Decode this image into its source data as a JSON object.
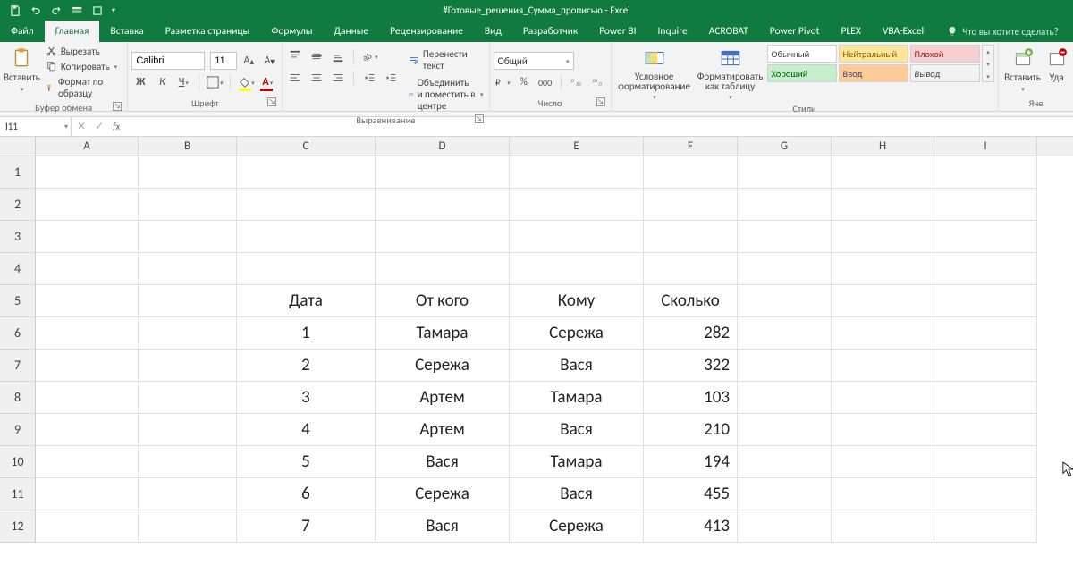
{
  "title": "#Готовые_решения_Сумма_прописью - Excel",
  "tabs": {
    "file": "Файл",
    "items": [
      "Главная",
      "Вставка",
      "Разметка страницы",
      "Формулы",
      "Данные",
      "Рецензирование",
      "Вид",
      "Разработчик",
      "Power BI",
      "Inquire",
      "ACROBAT",
      "Power Pivot",
      "PLEX",
      "VBA-Excel"
    ],
    "activeIndex": 0,
    "tellme": "Что вы хотите сделать?"
  },
  "ribbon": {
    "clipboard": {
      "label": "Буфер обмена",
      "paste": "Вставить",
      "cut": "Вырезать",
      "copy": "Копировать",
      "painter": "Формат по образцу"
    },
    "font": {
      "label": "Шрифт",
      "name": "Calibri",
      "size": "11"
    },
    "align": {
      "label": "Выравнивание",
      "wrap": "Перенести текст",
      "merge": "Объединить и поместить в центре"
    },
    "number": {
      "label": "Число",
      "format": "Общий"
    },
    "stylesGroup": {
      "label": "Стили",
      "cond": "Условное форматирование",
      "table": "Форматировать как таблицу",
      "cells": [
        "Обычный",
        "Нейтральный",
        "Плохой",
        "Хороший",
        "Ввод",
        "Вывод"
      ]
    },
    "cells": {
      "label": "Яче",
      "insert": "Вставить",
      "delete": "Уда"
    }
  },
  "formula": {
    "name": "I11",
    "value": ""
  },
  "sheet": {
    "columns": [
      "A",
      "B",
      "C",
      "D",
      "E",
      "F",
      "G",
      "H",
      "I"
    ],
    "rowNumbers": [
      1,
      2,
      3,
      4,
      5,
      6,
      7,
      8,
      9,
      10,
      11,
      12
    ],
    "header": {
      "C": "Дата",
      "D": "От кого",
      "E": "Кому",
      "F": "Сколько"
    },
    "data": [
      {
        "C": "1",
        "D": "Тамара",
        "E": "Сережа",
        "F": "282"
      },
      {
        "C": "2",
        "D": "Сережа",
        "E": "Вася",
        "F": "322"
      },
      {
        "C": "3",
        "D": "Артем",
        "E": "Тамара",
        "F": "103"
      },
      {
        "C": "4",
        "D": "Артем",
        "E": "Вася",
        "F": "210"
      },
      {
        "C": "5",
        "D": "Вася",
        "E": "Тамара",
        "F": "194"
      },
      {
        "C": "6",
        "D": "Сережа",
        "E": "Вася",
        "F": "455"
      },
      {
        "C": "7",
        "D": "Вася",
        "E": "Сережа",
        "F": "413"
      }
    ]
  }
}
